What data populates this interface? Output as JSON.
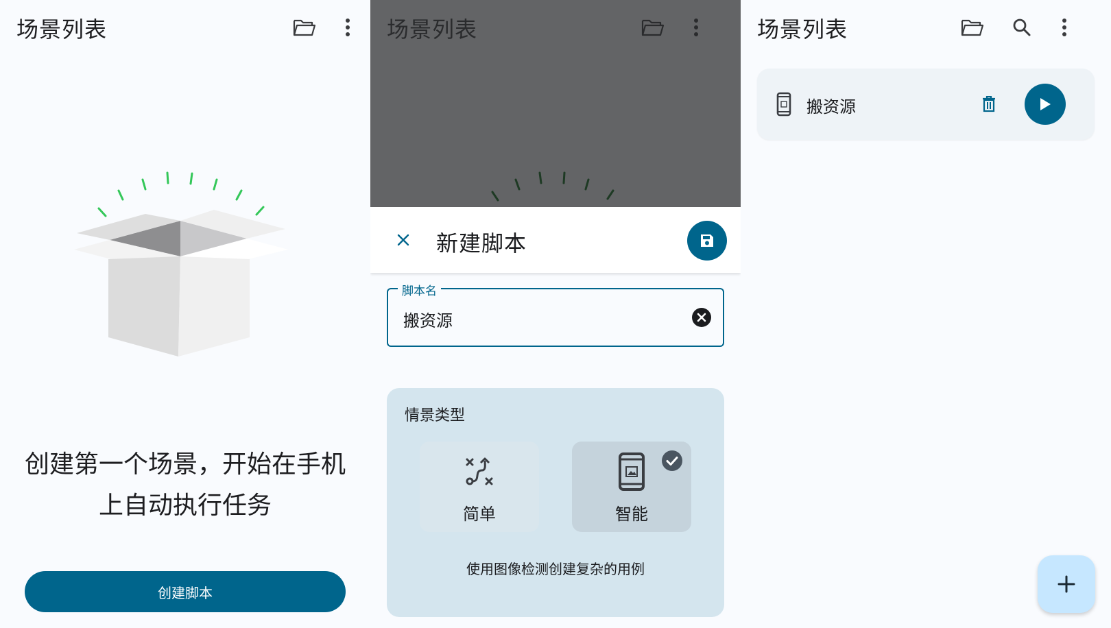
{
  "screens": {
    "empty": {
      "title": "场景列表",
      "icons": [
        "folder-open-icon",
        "more-vert-icon"
      ],
      "illustration": "open-box",
      "message_line1": "创建第一个场景，开始在手机",
      "message_line2": "上自动执行任务",
      "create_button": "创建脚本"
    },
    "new_script": {
      "title": "场景列表",
      "icons": [
        "folder-open-icon",
        "more-vert-icon"
      ],
      "sheet_title": "新建脚本",
      "name_field_label": "脚本名",
      "name_field_value": "搬资源",
      "type_card_title": "情景类型",
      "options": [
        {
          "label": "简单",
          "icon": "route-icon",
          "selected": false
        },
        {
          "label": "智能",
          "icon": "phone-image-icon",
          "selected": true
        }
      ],
      "option_description": "使用图像检测创建复杂的用例"
    },
    "list": {
      "title": "场景列表",
      "icons": [
        "folder-open-icon",
        "search-icon",
        "more-vert-icon"
      ],
      "scripts": [
        {
          "name": "搬资源",
          "icon": "phone-image-icon"
        }
      ],
      "fab_icon": "plus-icon"
    }
  },
  "colors": {
    "primary": "#00658c",
    "background": "#f9fbfe",
    "scrim": "#636466",
    "card": "#d4e5ee",
    "fab_container": "#c6e7ff",
    "box_accent": "#34c759"
  }
}
